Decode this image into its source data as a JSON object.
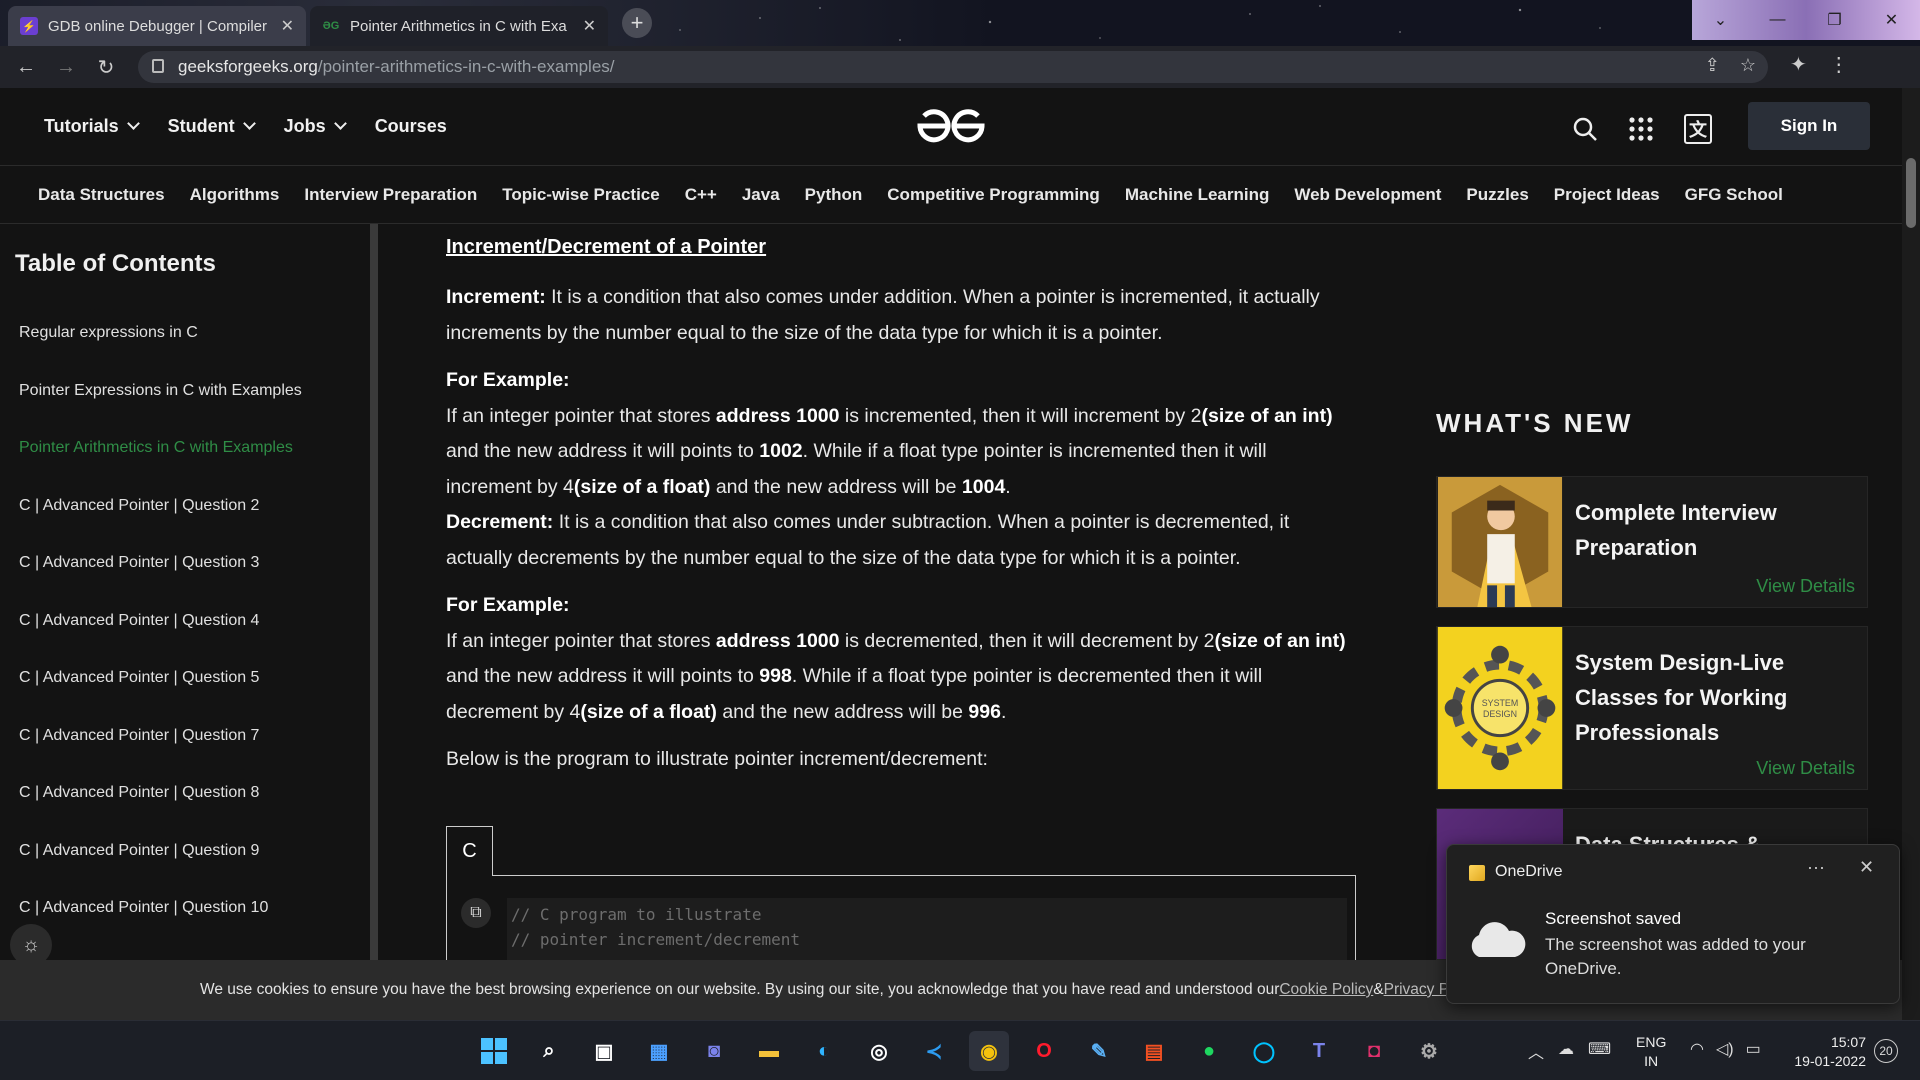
{
  "browser": {
    "tabs": [
      {
        "title": "GDB online Debugger | Compiler",
        "active": true
      },
      {
        "title": "Pointer Arithmetics in C with Exa",
        "active": false
      }
    ],
    "url_domain": "geeksforgeeks.org",
    "url_path": "/pointer-arithmetics-in-c-with-examples/"
  },
  "site": {
    "top_nav": [
      "Tutorials",
      "Student",
      "Jobs",
      "Courses"
    ],
    "logo": "GfG",
    "sign_in": "Sign In",
    "categories": [
      "Data Structures",
      "Algorithms",
      "Interview Preparation",
      "Topic-wise Practice",
      "C++",
      "Java",
      "Python",
      "Competitive Programming",
      "Machine Learning",
      "Web Development",
      "Puzzles",
      "Project Ideas",
      "GFG School"
    ]
  },
  "toc": {
    "title": "Table of Contents",
    "items": [
      "Regular expressions in C",
      "Pointer Expressions in C with Examples",
      "Pointer Arithmetics in C with Examples",
      "C | Advanced Pointer | Question 2",
      "C | Advanced Pointer | Question 3",
      "C | Advanced Pointer | Question 4",
      "C | Advanced Pointer | Question 5",
      "C | Advanced Pointer | Question 7",
      "C | Advanced Pointer | Question 8",
      "C | Advanced Pointer | Question 9",
      "C | Advanced Pointer | Question 10"
    ],
    "active_index": 2
  },
  "article": {
    "heading": "Increment/Decrement of a Pointer",
    "increment_label": "Increment:",
    "increment_text": " It is a condition that also comes under addition. When a pointer is incremented, it actually increments by the number equal to the size of the data type for which it is a pointer.",
    "example_label": "For Example:",
    "inc_ex": {
      "t1": "If an integer pointer that stores ",
      "b1": "address 1000",
      "t2": " is incremented, then it will increment by 2",
      "b2": "(size of an int)",
      "t3": " and the new address it will points to ",
      "b3": "1002",
      "t4": ". While if a float type pointer is incremented then it will increment by 4",
      "b4": "(size of a float)",
      "t5": " and the new address will be ",
      "b5": "1004",
      "t6": "."
    },
    "decrement_label": "Decrement:",
    "decrement_text": " It is a condition that also comes under subtraction. When a pointer is decremented, it actually decrements by the number equal to the size of the data type for which it is a pointer.",
    "dec_ex": {
      "t1": "If an integer pointer that stores ",
      "b1": "address 1000",
      "t2": " is decremented, then it will decrement by 2",
      "b2": "(size of an int)",
      "t3": " and the new address it will points to ",
      "b3": "998",
      "t4": ". While if a float type pointer is decremented then it will decrement by 4",
      "b4": "(size of a float)",
      "t5": " and the new address will be ",
      "b5": "996",
      "t6": "."
    },
    "below_text": "Below is the program to illustrate pointer increment/decrement:",
    "code_lang": "C",
    "code_lines": [
      "// C program to illustrate",
      "// pointer increment/decrement"
    ]
  },
  "whats_new": {
    "title": "WHAT'S NEW",
    "cards": [
      {
        "title": "Complete Interview Preparation",
        "link": "View Details"
      },
      {
        "title": "System Design-Live Classes for Working Professionals",
        "link": "View Details",
        "thumb_text": "SYSTEM DESIGN"
      },
      {
        "title": "Data Structures &"
      }
    ]
  },
  "cookie": {
    "text": "We use cookies to ensure you have the best browsing experience on our website. By using our site, you acknowledge that you have read and understood our ",
    "policy1": "Cookie Policy",
    "amp": " & ",
    "policy2": "Privacy Policy"
  },
  "toast": {
    "app": "OneDrive",
    "heading": "Screenshot saved",
    "body": "The screenshot was added to your OneDrive."
  },
  "taskbar": {
    "lang1": "ENG",
    "lang2": "IN",
    "time": "15:07",
    "date": "19-01-2022",
    "notifications": "20"
  },
  "colors": {
    "accent_green": "#2f8d46",
    "bg": "#131313"
  }
}
